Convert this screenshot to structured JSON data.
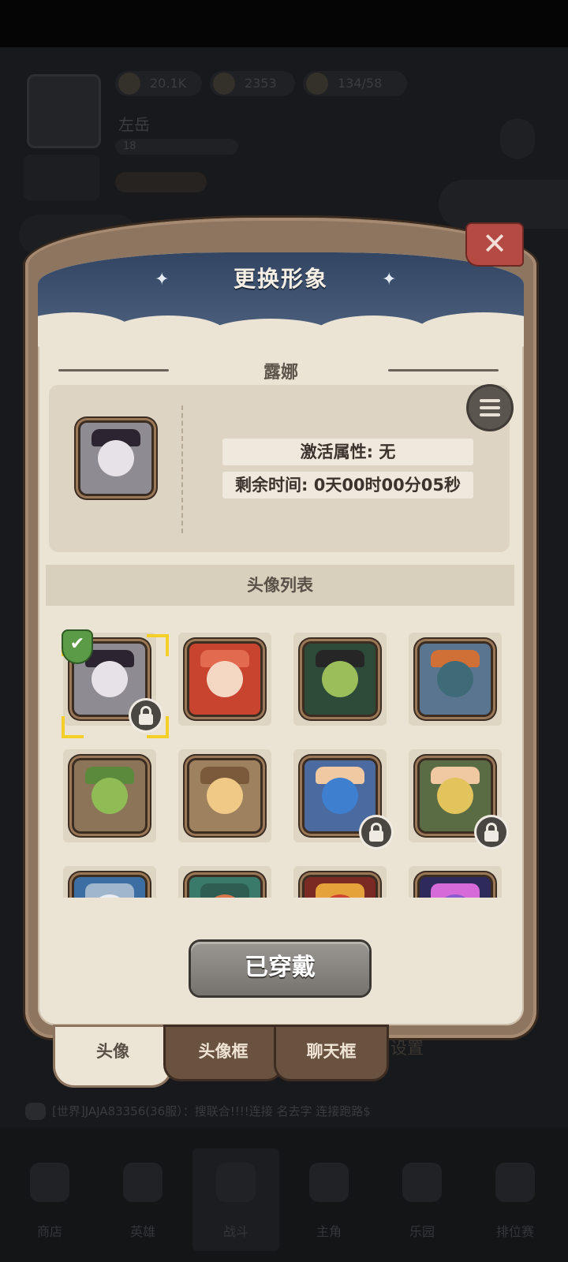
{
  "background": {
    "resources": [
      "20.1K",
      "2353",
      "134/58"
    ],
    "player_name": "左岳",
    "level": "18",
    "chat_line": "[世界]JAJA83356(36服）：搜联合!!!!连接 名去字 连接跑路$",
    "nav": [
      "商店",
      "英雄",
      "战斗",
      "主角",
      "乐园",
      "排位赛"
    ]
  },
  "dialog": {
    "title": "更换形象",
    "close_icon": "close-icon",
    "hero_name": "露娜",
    "activate_label": "激活属性: 无",
    "remaining_label": "剩余时间: 0天00时00分05秒",
    "list_title": "头像列表",
    "wear_button": "已穿戴"
  },
  "avatars": [
    {
      "id": "luna",
      "locked": true,
      "selected": true,
      "equipped": true,
      "colors": [
        "#8f8b92",
        "#e7e2e8",
        "#2c2430"
      ]
    },
    {
      "id": "rabbit-girl",
      "locked": false,
      "colors": [
        "#c8442f",
        "#f4d8c4",
        "#e26a4f"
      ]
    },
    {
      "id": "green-gunslinger",
      "locked": false,
      "colors": [
        "#2e4b3a",
        "#9bbd5a",
        "#262626"
      ]
    },
    {
      "id": "dwarf-viking",
      "locked": false,
      "colors": [
        "#5a7590",
        "#3f6b78",
        "#d06f36"
      ]
    },
    {
      "id": "leaf-goblin",
      "locked": false,
      "colors": [
        "#8b7457",
        "#8fbc55",
        "#5c8a3c"
      ]
    },
    {
      "id": "blonde-squire",
      "locked": false,
      "colors": [
        "#9e8260",
        "#f0c987",
        "#7a5a3a"
      ]
    },
    {
      "id": "blue-haired-ninja",
      "locked": true,
      "colors": [
        "#4a6aa0",
        "#3e7fcf",
        "#f0c9a3"
      ]
    },
    {
      "id": "hooded-ranger",
      "locked": true,
      "colors": [
        "#5a6c44",
        "#e3c35b",
        "#f0c9a3"
      ]
    },
    {
      "id": "white-wolf",
      "locked": false,
      "colors": [
        "#3d6ea3",
        "#e8eef3",
        "#9fb6cc"
      ]
    },
    {
      "id": "green-witch",
      "locked": false,
      "colors": [
        "#3a7a6a",
        "#d9764b",
        "#2e5e52"
      ]
    },
    {
      "id": "red-flower",
      "locked": false,
      "colors": [
        "#7a2a22",
        "#d0452f",
        "#e5a23b"
      ]
    },
    {
      "id": "purple-mage",
      "locked": false,
      "colors": [
        "#2e2a5c",
        "#8a5ad0",
        "#d66ad8"
      ]
    }
  ],
  "tabs": [
    "头像",
    "头像框",
    "聊天框"
  ],
  "tab_overflow": "设置",
  "active_tab": 0
}
